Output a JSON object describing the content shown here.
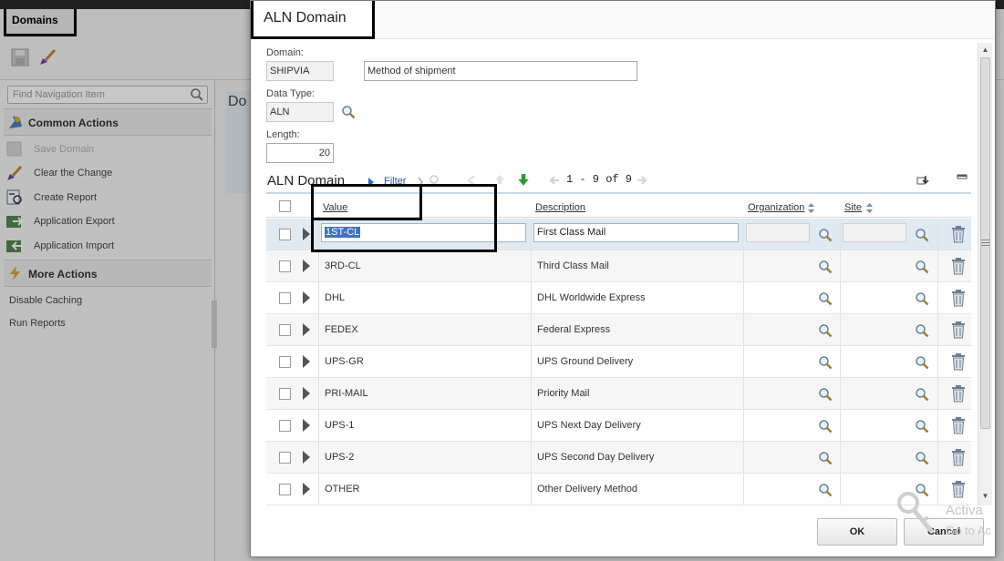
{
  "app": {
    "tab_label": "Domains",
    "bg_title": "Do",
    "nav_search_placeholder": "Find Navigation Item",
    "common_actions_title": "Common Actions",
    "common_actions": [
      "Save Domain",
      "Clear the Change",
      "Create Report",
      "Application Export",
      "Application Import"
    ],
    "more_actions_title": "More Actions",
    "more_actions": [
      "Disable Caching",
      "Run Reports"
    ]
  },
  "dialog": {
    "title": "ALN Domain",
    "domain_label": "Domain:",
    "domain_value": "SHIPVIA",
    "domain_description": "Method of shipment",
    "datatype_label": "Data Type:",
    "datatype_value": "ALN",
    "length_label": "Length:",
    "length_value": "20",
    "table_title": "ALN Domain",
    "filter_label": "Filter",
    "pager_text": "1 - 9 of 9",
    "columns": {
      "value": "Value",
      "description": "Description",
      "organization": "Organization",
      "site": "Site"
    },
    "rows": [
      {
        "value": "1ST-CL",
        "description": "First Class Mail"
      },
      {
        "value": "3RD-CL",
        "description": "Third Class Mail"
      },
      {
        "value": "DHL",
        "description": "DHL Worldwide Express"
      },
      {
        "value": "FEDEX",
        "description": "Federal Express"
      },
      {
        "value": "UPS-GR",
        "description": "UPS Ground Delivery"
      },
      {
        "value": "PRI-MAIL",
        "description": "Priority Mail"
      },
      {
        "value": "UPS-1",
        "description": "UPS Next Day Delivery"
      },
      {
        "value": "UPS-2",
        "description": "UPS Second Day Delivery"
      },
      {
        "value": "OTHER",
        "description": "Other Delivery Method"
      }
    ],
    "ok_label": "OK",
    "cancel_label": "Cancel"
  },
  "watermark": {
    "line1": "Activa",
    "line2": "Go to Ac"
  },
  "colors": {
    "accent": "#2559a7",
    "selected_row": "#dfeaf2",
    "selection_highlight": "#3b73c6"
  }
}
